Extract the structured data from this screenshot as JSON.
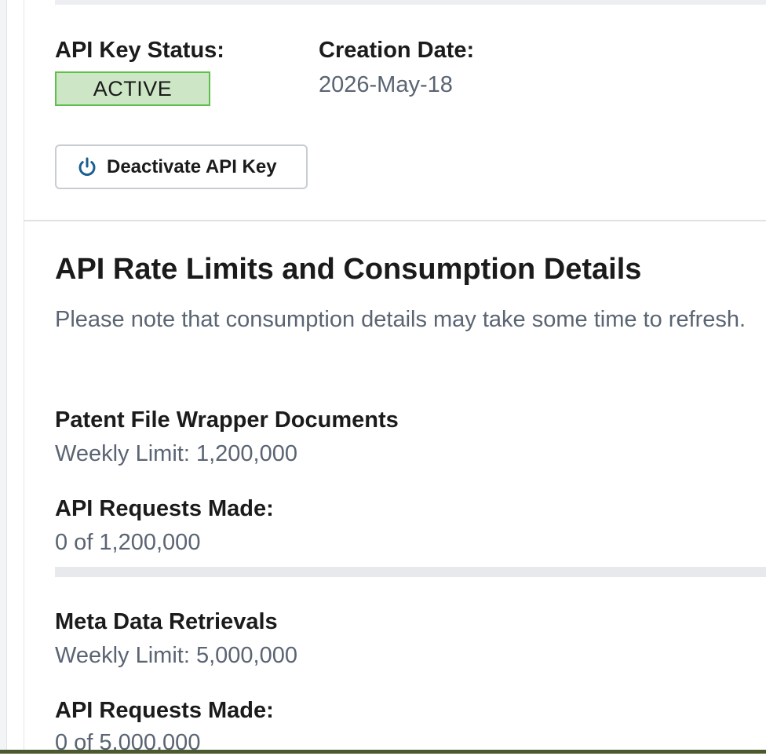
{
  "key_info": {
    "status_label": "API Key Status:",
    "status_value": "ACTIVE",
    "creation_label": "Creation Date:",
    "creation_value": "2026-May-18",
    "deactivate_button": "Deactivate API Key"
  },
  "rate_limits": {
    "title": "API Rate Limits and Consumption Details",
    "note": "Please note that consumption details may take some time to refresh.",
    "sections": [
      {
        "name": "Patent File Wrapper Documents",
        "weekly_limit": "Weekly Limit: 1,200,000",
        "requests_label": "API Requests Made:",
        "requests_value": "0 of 1,200,000"
      },
      {
        "name": "Meta Data Retrievals",
        "weekly_limit": "Weekly Limit: 5,000,000",
        "requests_label": "API Requests Made:",
        "requests_value": "0 of 5,000,000"
      }
    ]
  },
  "colors": {
    "status_active_bg": "#cde6c6",
    "status_active_border": "#5fbf4d",
    "power_icon": "#1a5f8f",
    "muted_text": "#5a6473"
  },
  "icons": {
    "deactivate": "power-icon"
  }
}
